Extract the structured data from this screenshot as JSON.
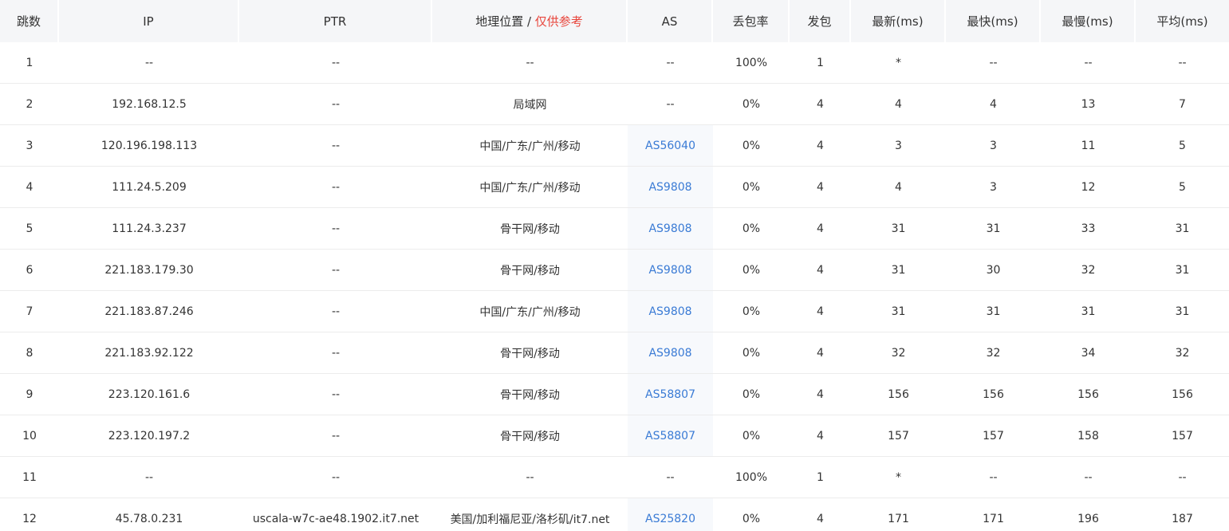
{
  "headers": {
    "hop": "跳数",
    "ip": "IP",
    "ptr": "PTR",
    "geo": "地理位置",
    "geo_sep": " / ",
    "geo_note": "仅供参考",
    "as": "AS",
    "loss": "丢包率",
    "sent": "发包",
    "last": "最新(ms)",
    "best": "最快(ms)",
    "worst": "最慢(ms)",
    "avg": "平均(ms)"
  },
  "colors": {
    "as_link": "#3a7bd5",
    "geo_note": "#e8453c",
    "header_bg": "#f5f6f8"
  },
  "rows": [
    {
      "hop": "1",
      "ip": "--",
      "ptr": "--",
      "geo": "--",
      "as": "--",
      "loss": "100%",
      "sent": "1",
      "last": "*",
      "best": "--",
      "worst": "--",
      "avg": "--"
    },
    {
      "hop": "2",
      "ip": "192.168.12.5",
      "ptr": "--",
      "geo": "局域网",
      "as": "--",
      "loss": "0%",
      "sent": "4",
      "last": "4",
      "best": "4",
      "worst": "13",
      "avg": "7"
    },
    {
      "hop": "3",
      "ip": "120.196.198.113",
      "ptr": "--",
      "geo": "中国/广东/广州/移动",
      "as": "AS56040",
      "loss": "0%",
      "sent": "4",
      "last": "3",
      "best": "3",
      "worst": "11",
      "avg": "5"
    },
    {
      "hop": "4",
      "ip": "111.24.5.209",
      "ptr": "--",
      "geo": "中国/广东/广州/移动",
      "as": "AS9808",
      "loss": "0%",
      "sent": "4",
      "last": "4",
      "best": "3",
      "worst": "12",
      "avg": "5"
    },
    {
      "hop": "5",
      "ip": "111.24.3.237",
      "ptr": "--",
      "geo": "骨干网/移动",
      "as": "AS9808",
      "loss": "0%",
      "sent": "4",
      "last": "31",
      "best": "31",
      "worst": "33",
      "avg": "31"
    },
    {
      "hop": "6",
      "ip": "221.183.179.30",
      "ptr": "--",
      "geo": "骨干网/移动",
      "as": "AS9808",
      "loss": "0%",
      "sent": "4",
      "last": "31",
      "best": "30",
      "worst": "32",
      "avg": "31"
    },
    {
      "hop": "7",
      "ip": "221.183.87.246",
      "ptr": "--",
      "geo": "中国/广东/广州/移动",
      "as": "AS9808",
      "loss": "0%",
      "sent": "4",
      "last": "31",
      "best": "31",
      "worst": "31",
      "avg": "31"
    },
    {
      "hop": "8",
      "ip": "221.183.92.122",
      "ptr": "--",
      "geo": "骨干网/移动",
      "as": "AS9808",
      "loss": "0%",
      "sent": "4",
      "last": "32",
      "best": "32",
      "worst": "34",
      "avg": "32"
    },
    {
      "hop": "9",
      "ip": "223.120.161.6",
      "ptr": "--",
      "geo": "骨干网/移动",
      "as": "AS58807",
      "loss": "0%",
      "sent": "4",
      "last": "156",
      "best": "156",
      "worst": "156",
      "avg": "156"
    },
    {
      "hop": "10",
      "ip": "223.120.197.2",
      "ptr": "--",
      "geo": "骨干网/移动",
      "as": "AS58807",
      "loss": "0%",
      "sent": "4",
      "last": "157",
      "best": "157",
      "worst": "158",
      "avg": "157"
    },
    {
      "hop": "11",
      "ip": "--",
      "ptr": "--",
      "geo": "--",
      "as": "--",
      "loss": "100%",
      "sent": "1",
      "last": "*",
      "best": "--",
      "worst": "--",
      "avg": "--"
    },
    {
      "hop": "12",
      "ip": "45.78.0.231",
      "ptr": "uscala-w7c-ae48.1902.it7.net",
      "geo": "美国/加利福尼亚/洛杉矶/it7.net",
      "as": "AS25820",
      "loss": "0%",
      "sent": "4",
      "last": "171",
      "best": "171",
      "worst": "196",
      "avg": "187"
    }
  ]
}
